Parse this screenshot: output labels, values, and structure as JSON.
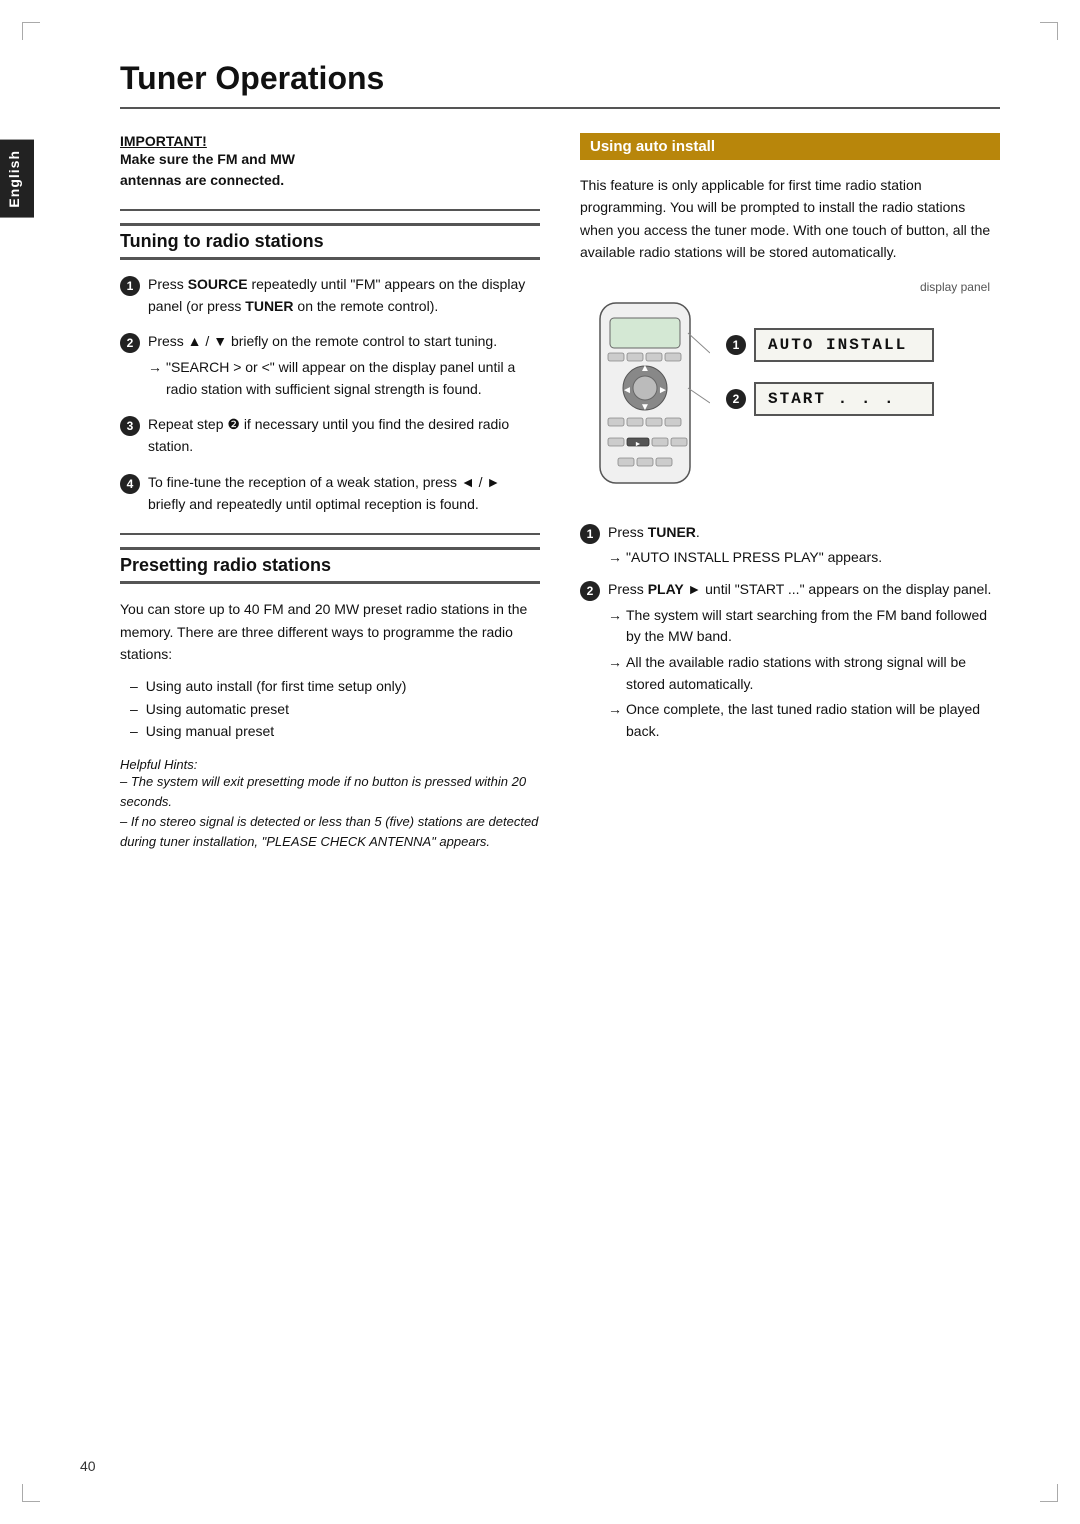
{
  "page": {
    "title": "Tuner Operations",
    "page_number": "40",
    "language_tab": "English"
  },
  "important": {
    "label": "IMPORTANT!",
    "text_line1": "Make sure the FM and MW",
    "text_line2": "antennas are connected."
  },
  "tuning_section": {
    "heading": "Tuning to radio stations",
    "items": [
      {
        "num": "1",
        "text": "Press SOURCE repeatedly until \"FM\" appears on the display panel (or press TUNER on the remote control)."
      },
      {
        "num": "2",
        "text": "Press ▲ / ▼ briefly on the remote control to start tuning.",
        "arrow": "→ \"SEARCH > or <\" will appear on the display panel until a radio station with sufficient signal strength is found."
      },
      {
        "num": "3",
        "text": "Repeat step ❷ if necessary until you find the desired radio station."
      },
      {
        "num": "4",
        "text": "To fine-tune the reception of a weak station, press ◄ / ► briefly and repeatedly until optimal reception is found."
      }
    ]
  },
  "presetting_section": {
    "heading": "Presetting radio stations",
    "intro": "You can store up to 40 FM and 20 MW preset radio stations in the memory. There are three different ways to programme the radio stations:",
    "bullets": [
      "Using auto install (for first time setup only)",
      "Using automatic preset",
      "Using manual preset"
    ],
    "helpful_hints_title": "Helpful Hints:",
    "hints": [
      "– The system will exit presetting mode if no button is pressed within 20 seconds.",
      "– If no stereo signal is detected or less than 5 (five) stations are detected during tuner installation, \"PLEASE CHECK ANTENNA\" appears."
    ]
  },
  "auto_install_section": {
    "heading": "Using auto install",
    "intro": "This feature is only applicable for first time radio station programming. You will be prompted to install the radio stations when you access the tuner mode. With one touch of button, all the available radio stations will be stored automatically.",
    "display_panel_label": "display panel",
    "screen1_num": "1",
    "screen1_text": "AUTO INSTALL",
    "screen2_num": "2",
    "screen2_text": "START . . .",
    "steps": [
      {
        "num": "1",
        "text": "Press TUNER.",
        "arrow": "→ \"AUTO INSTALL PRESS PLAY\" appears."
      },
      {
        "num": "2",
        "text": "Press PLAY ► until \"START ...\" appears on the display panel.",
        "arrows": [
          "→ The system will start searching from the FM band followed by the MW band.",
          "→ All the available radio stations with strong signal will be stored automatically.",
          "→ Once complete, the last tuned radio station will be played back."
        ]
      }
    ]
  }
}
